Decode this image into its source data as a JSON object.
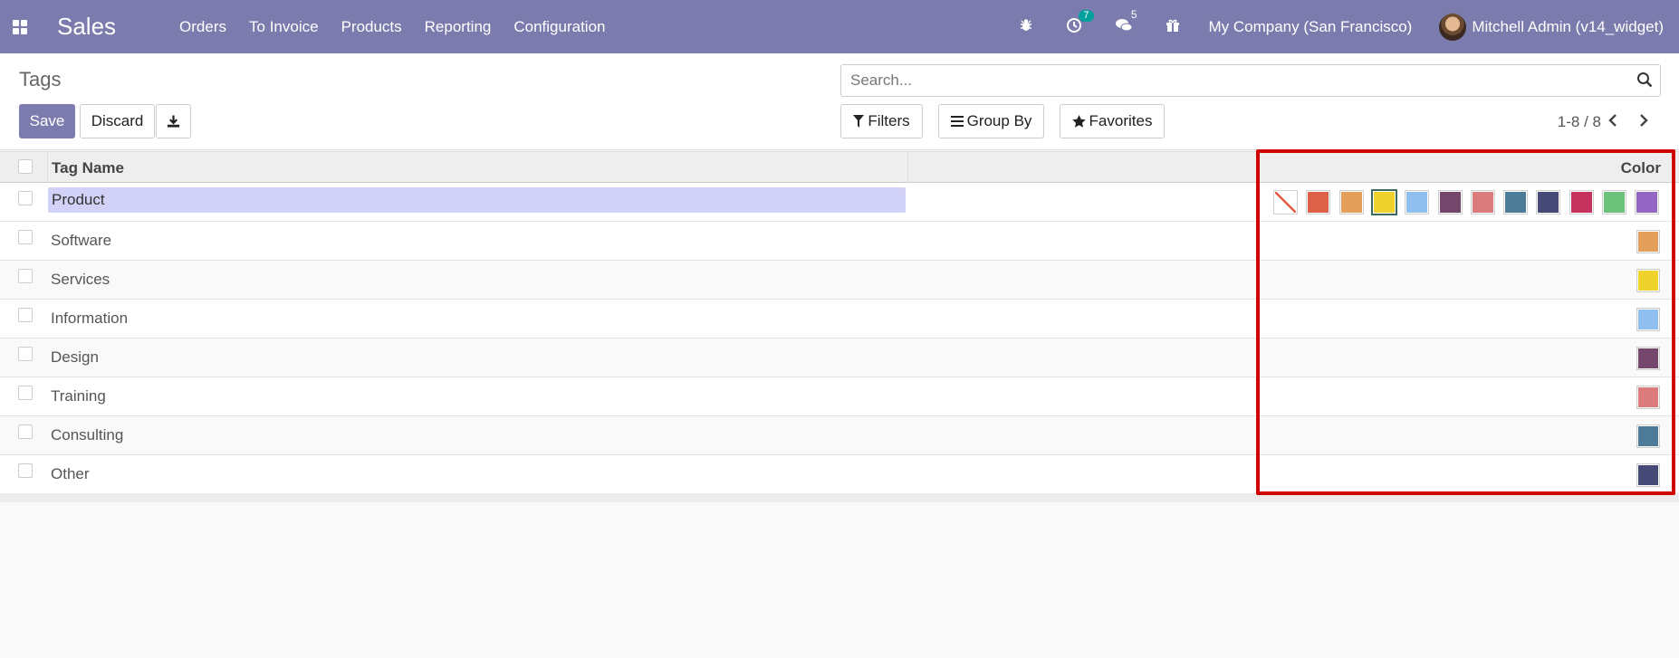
{
  "navbar": {
    "brand": "Sales",
    "menu": [
      "Orders",
      "To Invoice",
      "Products",
      "Reporting",
      "Configuration"
    ],
    "activity_count": "7",
    "messages_count": "5",
    "company": "My Company (San Francisco)",
    "user": "Mitchell Admin (v14_widget)"
  },
  "control_panel": {
    "title": "Tags",
    "save_label": "Save",
    "discard_label": "Discard",
    "search_placeholder": "Search...",
    "filters_label": "Filters",
    "groupby_label": "Group By",
    "favorites_label": "Favorites",
    "pager": "1-8 / 8"
  },
  "table": {
    "col_name": "Tag Name",
    "col_color": "Color",
    "editing_value": "Product",
    "rows": [
      {
        "name": "Software",
        "color": "#e4a05a"
      },
      {
        "name": "Services",
        "color": "#f0d22c"
      },
      {
        "name": "Information",
        "color": "#8fbfee"
      },
      {
        "name": "Design",
        "color": "#75466b"
      },
      {
        "name": "Training",
        "color": "#dc7b7b"
      },
      {
        "name": "Consulting",
        "color": "#4d7c98"
      },
      {
        "name": "Other",
        "color": "#454a77"
      }
    ]
  },
  "picker_colors": [
    "none",
    "#dd6149",
    "#e4a05a",
    "#f0d22c",
    "#8fbfee",
    "#75466b",
    "#dc7b7b",
    "#4d7c98",
    "#454a77",
    "#c6325e",
    "#6cc17b",
    "#9366c4"
  ],
  "picker_selected_index": 3
}
